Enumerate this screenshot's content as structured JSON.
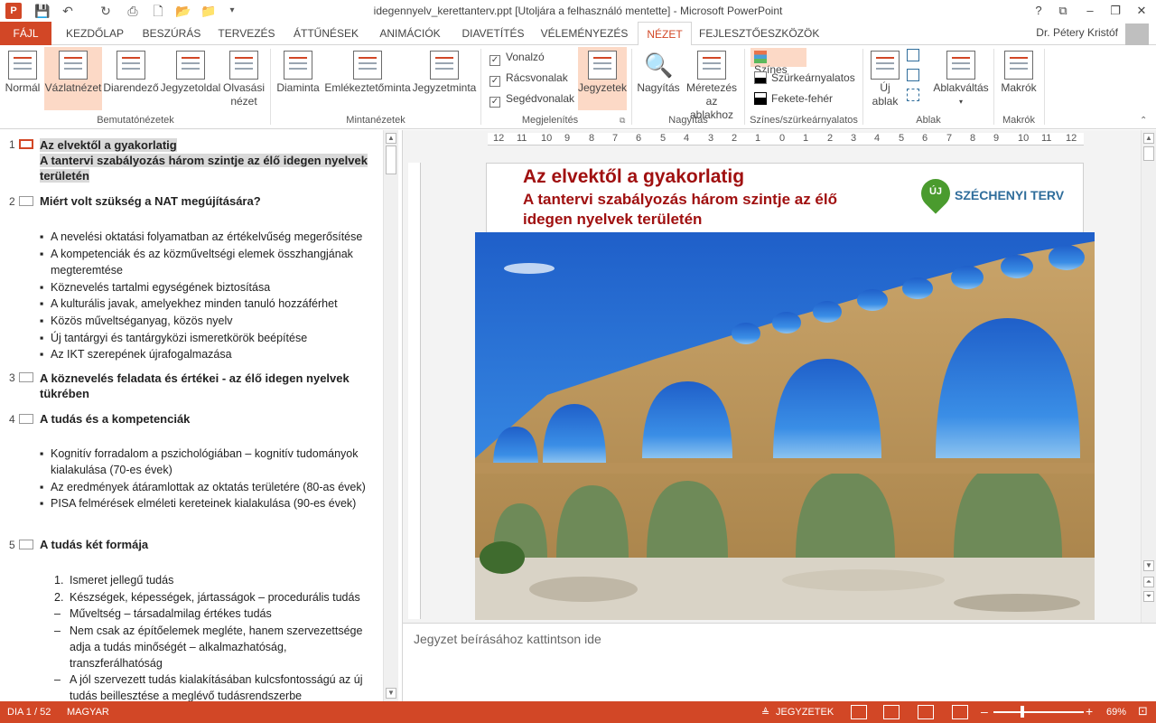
{
  "window": {
    "title": "idegennyelv_kerettanterv.ppt [Utoljára a felhasználó mentette] - Microsoft PowerPoint",
    "app_logo": "P",
    "help": "?",
    "restore": "⧉",
    "minimize": "–",
    "maximize": "❐",
    "close": "✕"
  },
  "ribbon_tabs": [
    "FÁJL",
    "KEZDŐLAP",
    "BESZÚRÁS",
    "TERVEZÉS",
    "ÁTTŰNÉSEK",
    "ANIMÁCIÓK",
    "DIAVETÍTÉS",
    "VÉLEMÉNYEZÉS",
    "NÉZET",
    "FEJLESZTŐESZKÖZÖK"
  ],
  "active_tab": "NÉZET",
  "user": {
    "name": "Dr. Pétery Kristóf"
  },
  "ribbon": {
    "presentation_views": {
      "label": "Bemutatónézetek",
      "buttons": [
        "Normál",
        "Vázlatnézet",
        "Diarendező",
        "Jegyzetoldal",
        "Olvasási nézet"
      ],
      "selected": "Vázlatnézet"
    },
    "master_views": {
      "label": "Mintanézetek",
      "buttons": [
        "Diaminta",
        "Emlékeztetőminta",
        "Jegyzetminta"
      ]
    },
    "show": {
      "label": "Megjelenítés",
      "checkboxes": [
        {
          "label": "Vonalzó",
          "checked": true
        },
        {
          "label": "Rácsvonalak",
          "checked": true
        },
        {
          "label": "Segédvonalak",
          "checked": true
        }
      ],
      "notes_button": "Jegyzetek"
    },
    "zoom": {
      "label": "Nagyítás",
      "buttons": [
        "Nagyítás",
        "Méretezés az ablakhoz"
      ]
    },
    "color": {
      "label": "Színes/szürkeárnyalatos",
      "options": [
        {
          "label": "Színes",
          "swatch": "#e8734a",
          "selected": true
        },
        {
          "label": "Szürkeárnyalatos",
          "swatch": "#7f7f7f",
          "selected": false
        },
        {
          "label": "Fekete-fehér",
          "swatch": "#000000",
          "selected": false
        }
      ]
    },
    "window": {
      "label": "Ablak",
      "buttons": [
        "Új ablak",
        "Ablakváltás"
      ]
    },
    "macros": {
      "label": "Makrók",
      "buttons": [
        "Makrók"
      ]
    }
  },
  "outline": {
    "slides": [
      {
        "num": "1",
        "title_line1": "Az elvektől a gyakorlatig",
        "title_line2": "A tantervi szabályozás három szintje az élő idegen nyelvek",
        "title_line3": "területén"
      },
      {
        "num": "2",
        "title": "Miért volt szükség a NAT megújítására?",
        "bullets": [
          "A nevelési oktatási folyamatban az értékelvűség megerősítése",
          "A kompetenciák és az közműveltségi elemek összhangjának megteremtése",
          "Köznevelés tartalmi egységének biztosítása",
          "A kulturális javak, amelyekhez minden tanuló hozzáférhet",
          "Közös műveltséganyag, közös nyelv",
          "Új tantárgyi és tantárgyközi ismeretkörök beépítése",
          "Az IKT szerepének újrafogalmazása"
        ]
      },
      {
        "num": "3",
        "title": "A köznevelés feladata és értékei - az élő idegen nyelvek tükrében"
      },
      {
        "num": "4",
        "title": "A tudás és a kompetenciák",
        "bullets": [
          "Kognitív forradalom a pszichológiában – kognitív tudományok kialakulása (70-es évek)",
          "Az eredmények átáramlottak az oktatás területére (80-as évek)",
          "PISA felmérések elméleti kereteinek kialakulása (90-es évek)"
        ]
      },
      {
        "num": "5",
        "title": "A tudás két formája",
        "items": [
          {
            "marker": "1.",
            "text": "Ismeret jellegű tudás"
          },
          {
            "marker": "2.",
            "text": "Készségek, képességek, jártasságok – procedurális tudás"
          },
          {
            "marker": "–",
            "text": "Műveltség – társadalmilag értékes tudás"
          },
          {
            "marker": "–",
            "text": "Nem csak az építőelemek megléte, hanem szervezettsége adja a tudás minőségét – alkalmazhatóság, transzferálhatóság"
          },
          {
            "marker": "–",
            "text": "A jól szervezett tudás kialakításában kulcsfontosságú az új tudás beillesztése a meglévő tudásrendszerbe"
          }
        ]
      }
    ]
  },
  "ruler": {
    "h_ticks": [
      "12",
      "11",
      "10",
      "9",
      "8",
      "7",
      "6",
      "5",
      "4",
      "3",
      "2",
      "1",
      "0",
      "1",
      "2",
      "3",
      "4",
      "5",
      "6",
      "7",
      "8",
      "9",
      "10",
      "11",
      "12"
    ]
  },
  "slide": {
    "title": "Az elvektől a gyakorlatig",
    "subtitle": "A tantervi szabályozás három szintje az élő idegen nyelvek területén",
    "logo_pin": "ÚJ",
    "logo_text": "SZÉCHENYI TERV"
  },
  "notes": {
    "placeholder": "Jegyzet beírásához kattintson ide"
  },
  "status": {
    "slide": "DIA 1 / 52",
    "language": "MAGYAR",
    "notes": "JEGYZETEK",
    "zoom": "69%"
  }
}
